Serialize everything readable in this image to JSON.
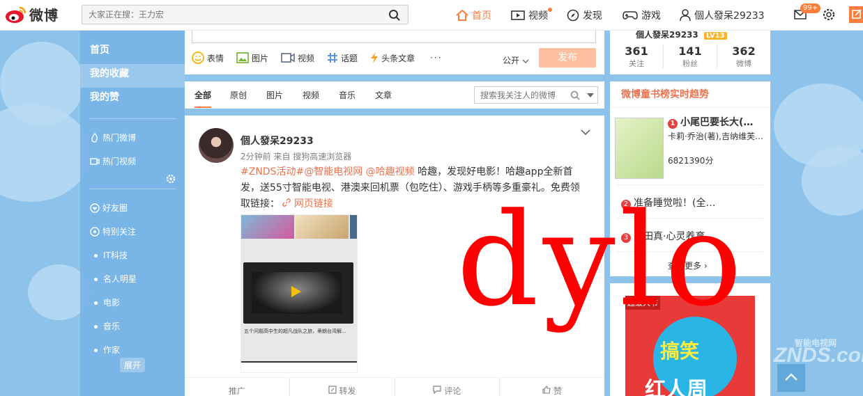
{
  "header": {
    "logo_text": "微博",
    "search_placeholder": "大家正在搜：王力宏",
    "nav": [
      {
        "label": "首页"
      },
      {
        "label": "视频"
      },
      {
        "label": "发现"
      },
      {
        "label": "游戏"
      },
      {
        "label": "個人發呆29233"
      }
    ],
    "message_badge": "99+"
  },
  "sidebar": {
    "main": [
      {
        "label": "首页"
      },
      {
        "label": "我的收藏"
      },
      {
        "label": "我的赞"
      }
    ],
    "links": [
      {
        "label": "热门微博"
      },
      {
        "label": "热门视频"
      }
    ],
    "groups": [
      {
        "label": "好友圈"
      },
      {
        "label": "特别关注"
      }
    ],
    "bullets": [
      {
        "label": "IT科技"
      },
      {
        "label": "名人明星"
      },
      {
        "label": "电影"
      },
      {
        "label": "音乐"
      },
      {
        "label": "作家"
      }
    ],
    "expand_label": "展开"
  },
  "composer": {
    "tools": [
      {
        "label": "表情"
      },
      {
        "label": "图片"
      },
      {
        "label": "视频"
      },
      {
        "label": "话题"
      },
      {
        "label": "头条文章"
      },
      {
        "label": "···"
      }
    ],
    "visibility": "公开",
    "publish": "发布"
  },
  "feed_tabs": {
    "tabs": [
      "全部",
      "原创",
      "图片",
      "视频",
      "音乐",
      "文章"
    ],
    "search_placeholder": "搜索我关注人的微博"
  },
  "post": {
    "author": "個人發呆29233",
    "meta": "2分钟前 来自 搜狗高速浏览器",
    "text_link1": "#ZNDS活动#@智能电视网 @哈趣视频",
    "text_body": " 哈趣，发现好电影！哈趣app全新首发，送55寸智能电视、港澳来回机票（包吃住）、游戏手柄等多重豪礼。免费领取链接：",
    "text_link2": "网页链接",
    "thumb_caption": "五个问题高中生的超凡战队之旅，蒂朗台湾解…",
    "actions": [
      "推广",
      "转发",
      "评论",
      "赞"
    ]
  },
  "profile": {
    "name": "個人發呆29233",
    "level": "LV13",
    "stats": [
      {
        "n": "361",
        "l": "关注"
      },
      {
        "n": "141",
        "l": "粉丝"
      },
      {
        "n": "362",
        "l": "微博"
      }
    ]
  },
  "trend": {
    "title": "微博童书榜实时趋势",
    "item1_title": "小尾巴要长大(…",
    "item1_author": "卡莉·乔治(著),吉纳维芙…",
    "item1_score": "6821390分",
    "item2": "准备睡觉啦！(全…",
    "item3": "七田真·心灵养育…",
    "see_more": "查看更多"
  },
  "ad": {
    "tag": "超级人节",
    "line1": "搞笑",
    "line2": "红人周"
  },
  "watermark": "dylo",
  "brand_mark": "ZNDS.com",
  "brand_mark_cn": "智能电视网"
}
